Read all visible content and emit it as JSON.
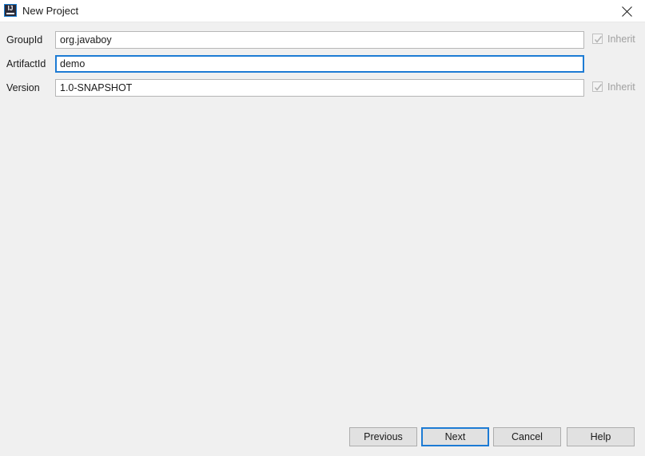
{
  "window": {
    "title": "New Project",
    "icon": "intellij-idea-icon",
    "icon_text": "IJ",
    "close_icon": "close-icon",
    "accent_color": "#1d7bd4",
    "body_background": "#f0f0f0",
    "titlebar_background": "#ffffff"
  },
  "form": {
    "fields": [
      {
        "label": "GroupId",
        "value": "org.javaboy",
        "placeholder": "",
        "focused": false,
        "inherit": {
          "label": "Inherit",
          "checked": true,
          "disabled": true
        }
      },
      {
        "label": "ArtifactId",
        "value": "demo",
        "placeholder": "",
        "focused": true,
        "inherit": null
      },
      {
        "label": "Version",
        "value": "1.0-SNAPSHOT",
        "placeholder": "",
        "focused": false,
        "inherit": {
          "label": "Inherit",
          "checked": true,
          "disabled": true
        }
      }
    ]
  },
  "buttons": {
    "previous": "Previous",
    "next": "Next",
    "cancel": "Cancel",
    "help": "Help",
    "default_button": "Next"
  }
}
